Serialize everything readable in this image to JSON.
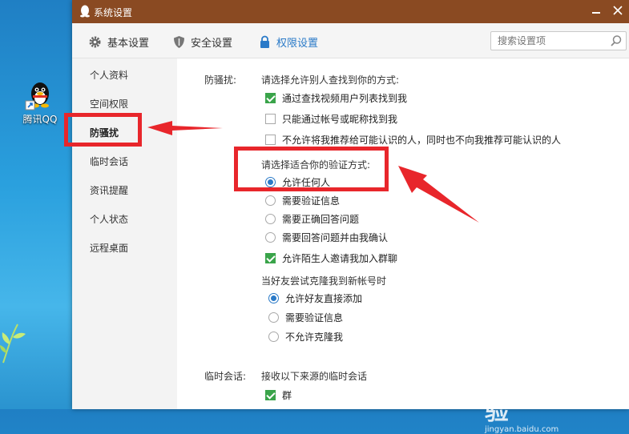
{
  "desktop": {
    "icon_label": "腾讯QQ"
  },
  "window": {
    "title": "系统设置",
    "tabs": [
      {
        "label": "基本设置",
        "icon": "gear-icon"
      },
      {
        "label": "安全设置",
        "icon": "shield-icon"
      },
      {
        "label": "权限设置",
        "icon": "lock-icon",
        "active": true
      }
    ],
    "search_placeholder": "搜索设置项"
  },
  "sidebar": {
    "items": [
      {
        "label": "个人资料"
      },
      {
        "label": "空间权限"
      },
      {
        "label": "防骚扰",
        "active": true
      },
      {
        "label": "临时会话"
      },
      {
        "label": "资讯提醒"
      },
      {
        "label": "个人状态"
      },
      {
        "label": "远程桌面"
      }
    ]
  },
  "harass": {
    "section_label": "防骚扰:",
    "find_heading": "请选择允许别人查找到你的方式:",
    "find_options": [
      {
        "label": "通过查找视频用户列表找到我",
        "checked": true
      },
      {
        "label": "只能通过帐号或昵称找到我",
        "checked": false
      },
      {
        "label": "不允许将我推荐给可能认识的人，同时也不向我推荐可能认识的人",
        "checked": false
      }
    ],
    "verify_heading": "请选择适合你的验证方式:",
    "verify_options": [
      {
        "label": "允许任何人",
        "selected": true
      },
      {
        "label": "需要验证信息",
        "selected": false
      },
      {
        "label": "需要正确回答问题",
        "selected": false
      },
      {
        "label": "需要回答问题并由我确认",
        "selected": false
      }
    ],
    "group_invite": {
      "label": "允许陌生人邀请我加入群聊",
      "checked": true
    },
    "clone_heading": "当好友尝试克隆我到新帐号时",
    "clone_options": [
      {
        "label": "允许好友直接添加",
        "selected": true
      },
      {
        "label": "需要验证信息",
        "selected": false
      },
      {
        "label": "不允许克隆我",
        "selected": false
      }
    ]
  },
  "temp_chat": {
    "section_label": "临时会话:",
    "heading": "接收以下来源的临时会话",
    "options": [
      {
        "label": "群",
        "checked": true
      }
    ]
  },
  "watermark": {
    "brand": "Baidu经验",
    "url": "jingyan.baidu.com"
  },
  "colors": {
    "titlebar": "#8a4a22",
    "accent": "#2a7ac8",
    "check": "#3aa44a",
    "highlight": "#e8262b"
  }
}
